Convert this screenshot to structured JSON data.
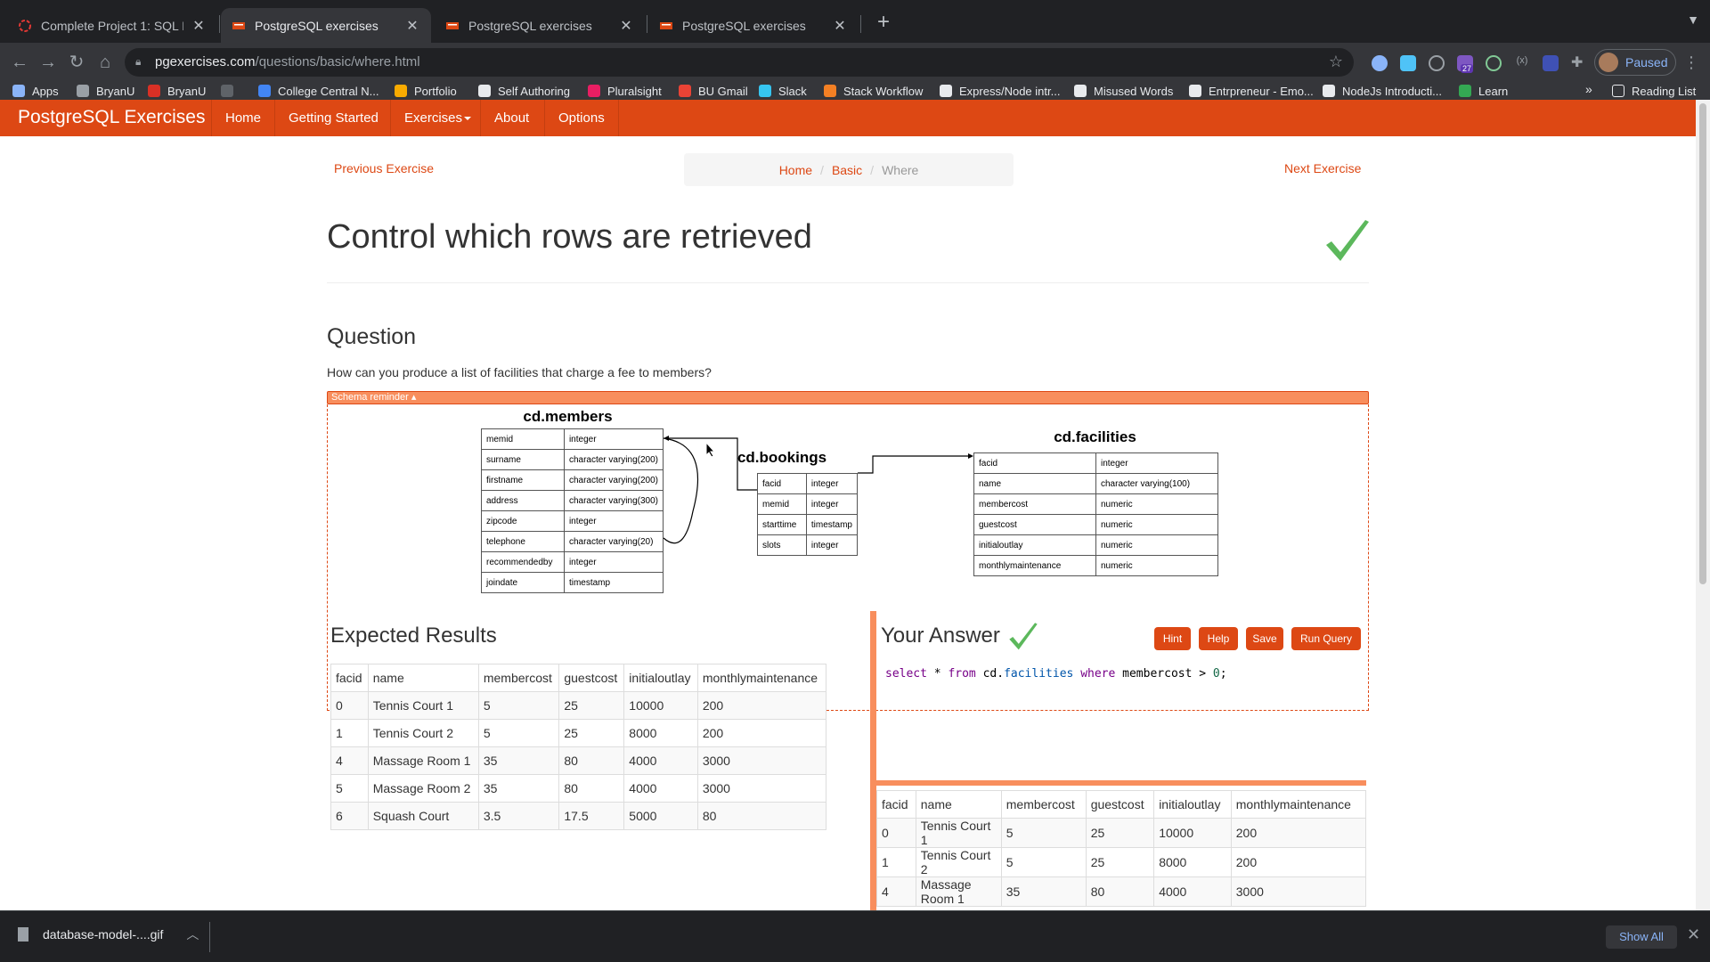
{
  "browser": {
    "tabs": [
      {
        "title": "Complete Project 1: SQL Practi",
        "active": false
      },
      {
        "title": "PostgreSQL exercises",
        "active": true
      },
      {
        "title": "PostgreSQL exercises",
        "active": false
      },
      {
        "title": "PostgreSQL exercises",
        "active": false
      }
    ],
    "url_domain": "pgexercises.com",
    "url_path": "/questions/basic/where.html",
    "profile_label": "Paused",
    "extension_badge": "27",
    "bookmarks": [
      {
        "label": "Apps",
        "color": "#8ab4f8"
      },
      {
        "label": "BryanU",
        "color": "#9aa0a6"
      },
      {
        "label": "BryanU",
        "color": "#d93025"
      },
      {
        "label": "",
        "color": "#5f6368"
      },
      {
        "label": "College Central N...",
        "color": "#4285f4"
      },
      {
        "label": "Portfolio",
        "color": "#f9ab00"
      },
      {
        "label": "Self Authoring",
        "color": "#e8eaed"
      },
      {
        "label": "Pluralsight",
        "color": "#e91e63"
      },
      {
        "label": "BU Gmail",
        "color": "#ea4335"
      },
      {
        "label": "Slack",
        "color": "#36c5f0"
      },
      {
        "label": "Stack Workflow",
        "color": "#f48024"
      },
      {
        "label": "Express/Node intr...",
        "color": "#e8eaed"
      },
      {
        "label": "Misused Words",
        "color": "#e8eaed"
      },
      {
        "label": "Entrpreneur - Emo...",
        "color": "#e8eaed"
      },
      {
        "label": "NodeJs Introducti...",
        "color": "#e8eaed"
      },
      {
        "label": "Learn",
        "color": "#34a853"
      }
    ],
    "bookmarks_more": "»",
    "reading_list": "Reading List"
  },
  "site": {
    "brand": "PostgreSQL Exercises",
    "nav": [
      "Home",
      "Getting Started",
      "Exercises",
      "About",
      "Options"
    ],
    "prev": "Previous Exercise",
    "next": "Next Exercise",
    "breadcrumb": [
      "Home",
      "Basic",
      "Where"
    ],
    "title": "Control which rows are retrieved",
    "question_heading": "Question",
    "question_text": "How can you produce a list of facilities that charge a fee to members?",
    "schema_label": "Schema reminder ▴",
    "accent_color": "#dd4814"
  },
  "schema": {
    "members": {
      "title": "cd.members",
      "rows": [
        [
          "memid",
          "integer"
        ],
        [
          "surname",
          "character varying(200)"
        ],
        [
          "firstname",
          "character varying(200)"
        ],
        [
          "address",
          "character varying(300)"
        ],
        [
          "zipcode",
          "integer"
        ],
        [
          "telephone",
          "character varying(20)"
        ],
        [
          "recommendedby",
          "integer"
        ],
        [
          "joindate",
          "timestamp"
        ]
      ]
    },
    "bookings": {
      "title": "cd.bookings",
      "rows": [
        [
          "facid",
          "integer"
        ],
        [
          "memid",
          "integer"
        ],
        [
          "starttime",
          "timestamp"
        ],
        [
          "slots",
          "integer"
        ]
      ]
    },
    "facilities": {
      "title": "cd.facilities",
      "rows": [
        [
          "facid",
          "integer"
        ],
        [
          "name",
          "character varying(100)"
        ],
        [
          "membercost",
          "numeric"
        ],
        [
          "guestcost",
          "numeric"
        ],
        [
          "initialoutlay",
          "numeric"
        ],
        [
          "monthlymaintenance",
          "numeric"
        ]
      ]
    }
  },
  "expected": {
    "heading": "Expected Results",
    "columns": [
      "facid",
      "name",
      "membercost",
      "guestcost",
      "initialoutlay",
      "monthlymaintenance"
    ],
    "rows": [
      [
        "0",
        "Tennis Court 1",
        "5",
        "25",
        "10000",
        "200"
      ],
      [
        "1",
        "Tennis Court 2",
        "5",
        "25",
        "8000",
        "200"
      ],
      [
        "4",
        "Massage Room 1",
        "35",
        "80",
        "4000",
        "3000"
      ],
      [
        "5",
        "Massage Room 2",
        "35",
        "80",
        "4000",
        "3000"
      ],
      [
        "6",
        "Squash Court",
        "3.5",
        "17.5",
        "5000",
        "80"
      ]
    ]
  },
  "answer": {
    "heading": "Your Answer",
    "buttons": [
      "Hint",
      "Help",
      "Save",
      "Run Query"
    ],
    "query_tokens": [
      {
        "t": "select",
        "c": "kw"
      },
      {
        "t": " * ",
        "c": ""
      },
      {
        "t": "from",
        "c": "kw"
      },
      {
        "t": " cd.",
        "c": ""
      },
      {
        "t": "facilities",
        "c": "ref"
      },
      {
        "t": " ",
        "c": ""
      },
      {
        "t": "where",
        "c": "kw"
      },
      {
        "t": " membercost > ",
        "c": ""
      },
      {
        "t": "0",
        "c": "num"
      },
      {
        "t": ";",
        "c": ""
      }
    ],
    "columns": [
      "facid",
      "name",
      "membercost",
      "guestcost",
      "initialoutlay",
      "monthlymaintenance"
    ],
    "rows": [
      [
        "0",
        "Tennis Court 1",
        "5",
        "25",
        "10000",
        "200"
      ],
      [
        "1",
        "Tennis Court 2",
        "5",
        "25",
        "8000",
        "200"
      ],
      [
        "4",
        "Massage Room 1",
        "35",
        "80",
        "4000",
        "3000"
      ]
    ]
  },
  "downloads": {
    "file": "database-model-....gif",
    "show_all": "Show All"
  }
}
